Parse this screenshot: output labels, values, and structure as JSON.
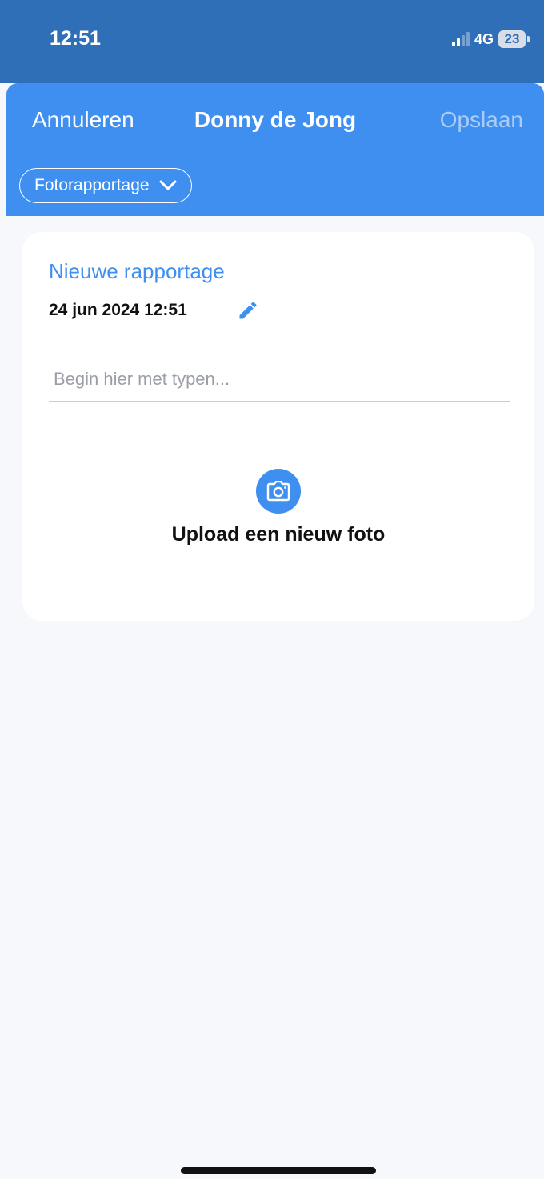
{
  "status_bar": {
    "time": "12:51",
    "network": "4G",
    "battery": "23",
    "colors": {
      "background": "#2f6fb7"
    }
  },
  "header": {
    "cancel_label": "Annuleren",
    "title": "Donny de Jong",
    "save_label": "Opslaan",
    "report_type": "Fotorapportage",
    "icons": {
      "dropdown": "chevron-down-icon"
    },
    "colors": {
      "background": "#3f8ff0",
      "save_disabled": "#a9cdf7"
    }
  },
  "report_card": {
    "title": "Nieuwe rapportage",
    "datetime": "24 jun 2024 12:51",
    "text_placeholder": "Begin hier met typen...",
    "upload_label": "Upload een nieuw foto",
    "icons": {
      "edit": "pencil-icon",
      "upload": "camera-icon"
    },
    "colors": {
      "accent": "#3f8ff0"
    }
  }
}
